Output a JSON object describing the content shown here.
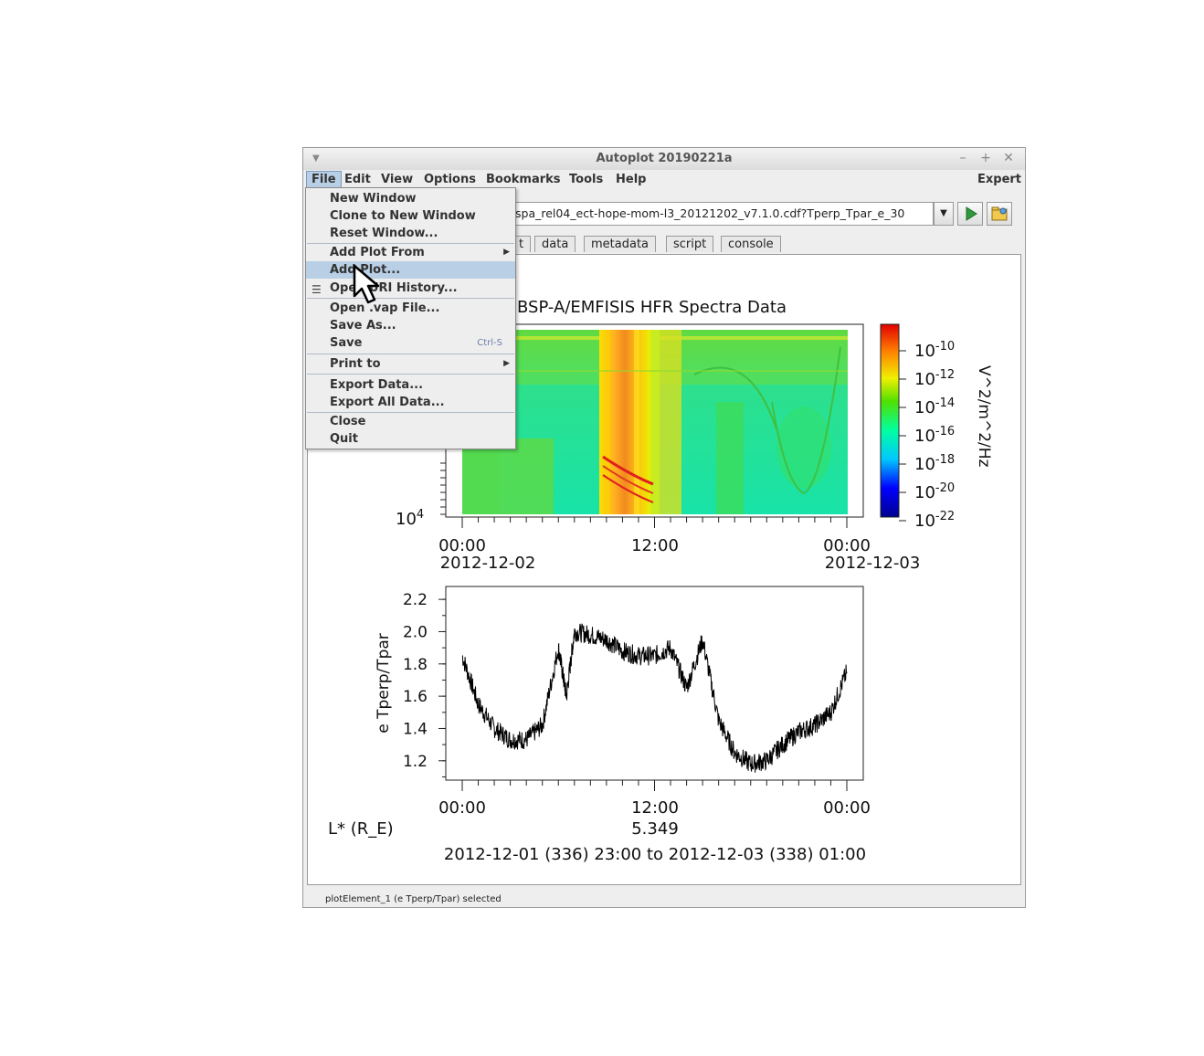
{
  "window": {
    "title": "Autoplot 20190221a"
  },
  "menubar": {
    "items": [
      "File",
      "Edit",
      "View",
      "Options",
      "Bookmarks",
      "Tools",
      "Help"
    ],
    "expert_label": "Expert"
  },
  "uri": {
    "value": "spa_rel04_ect-hope-mom-l3_20121202_v7.1.0.cdf?Tperp_Tpar_e_30"
  },
  "tabs": [
    "t",
    "data",
    "metadata",
    "script",
    "console"
  ],
  "file_menu": {
    "items": [
      {
        "label": "New Window"
      },
      {
        "label": "Clone to New Window"
      },
      {
        "label": "Reset Window..."
      },
      {
        "label": "Add Plot From"
      },
      {
        "label": "Add Plot..."
      },
      {
        "label": "Open URI History..."
      },
      {
        "label": "Open .vap File..."
      },
      {
        "label": "Save As..."
      },
      {
        "label": "Save",
        "accel": "Ctrl-S"
      },
      {
        "label": "Print to"
      },
      {
        "label": "Export Data..."
      },
      {
        "label": "Export All Data..."
      },
      {
        "label": "Close"
      },
      {
        "label": "Quit"
      }
    ]
  },
  "status": {
    "text": "plotElement_1 (e Tperp/Tpar) selected"
  },
  "chart_data": [
    {
      "type": "heatmap",
      "title": "BSP-A/EMFISIS  HFR Spectra Data",
      "y_tick_labels": [
        "10^4"
      ],
      "x_tick_labels": [
        "00:00",
        "12:00",
        "00:00"
      ],
      "x_date_labels": [
        "2012-12-02",
        "",
        "2012-12-03"
      ],
      "colorbar": {
        "label": "V^2/m^2/Hz",
        "tick_labels": [
          "10^-10",
          "10^-12",
          "10^-14",
          "10^-16",
          "10^-18",
          "10^-20",
          "10^-22"
        ],
        "scale": "log"
      }
    },
    {
      "type": "line",
      "ylabel": "e Tperp/Tpar",
      "y_tick_labels": [
        "2.2",
        "2.0",
        "1.8",
        "1.6",
        "1.4",
        "1.2"
      ],
      "x_tick_labels": [
        "00:00",
        "12:00",
        "00:00"
      ],
      "x_hours": [
        0,
        1,
        2,
        3,
        4,
        5,
        6,
        6.5,
        7,
        8,
        9,
        10,
        11,
        12,
        13,
        14,
        15,
        16,
        17,
        18,
        19,
        20,
        21,
        22,
        23,
        24
      ],
      "series": [
        {
          "values": [
            1.85,
            1.55,
            1.4,
            1.33,
            1.33,
            1.42,
            1.9,
            1.6,
            2.0,
            1.98,
            1.95,
            1.88,
            1.85,
            1.85,
            1.9,
            1.65,
            1.95,
            1.45,
            1.25,
            1.18,
            1.2,
            1.3,
            1.38,
            1.42,
            1.5,
            1.75
          ]
        }
      ],
      "extra_labels": {
        "row_label": "L* (R_E)",
        "row_value": "5.349",
        "time_range": "2012-12-01 (336) 23:00 to 2012-12-03 (338) 01:00"
      }
    }
  ]
}
